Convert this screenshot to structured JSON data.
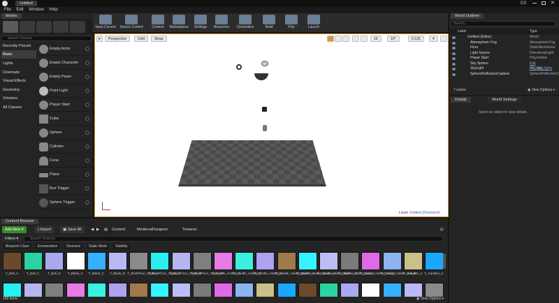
{
  "window": {
    "title": "Untitled",
    "user": "DS"
  },
  "menu": [
    "File",
    "Edit",
    "Window",
    "Help"
  ],
  "modes_tab": "Modes",
  "placement": {
    "search_placeholder": "Search Classes",
    "categories": [
      "Recently Placed",
      "Basic",
      "Lights",
      "Cinematic",
      "Visual Effects",
      "Geometry",
      "Volumes",
      "All Classes"
    ],
    "items": [
      "Empty Actor",
      "Empty Character",
      "Empty Pawn",
      "Point Light",
      "Player Start",
      "Cube",
      "Sphere",
      "Cylinder",
      "Cone",
      "Plane",
      "Box Trigger",
      "Sphere Trigger"
    ]
  },
  "toolbar": [
    {
      "label": "Save Current",
      "icon": "save-icon"
    },
    {
      "label": "Source Control",
      "icon": "source-control-icon"
    },
    {
      "label": "Content",
      "icon": "content-icon"
    },
    {
      "label": "Marketplace",
      "icon": "marketplace-icon"
    },
    {
      "label": "Settings",
      "icon": "settings-icon"
    },
    {
      "label": "Blueprints",
      "icon": "blueprints-icon"
    },
    {
      "label": "Cinematics",
      "icon": "cinematics-icon"
    },
    {
      "label": "Build",
      "icon": "build-icon"
    },
    {
      "label": "Play",
      "icon": "play-icon"
    },
    {
      "label": "Launch",
      "icon": "launch-icon"
    }
  ],
  "viewport": {
    "perspective": "Perspective",
    "lit": "Unlit",
    "show": "Show",
    "grid": "10",
    "angle": "10°",
    "scale": "0.125",
    "cam": "4",
    "level_label": "Level:",
    "level_name": "Untitled (Persistent)"
  },
  "outliner": {
    "tab": "World Outliner",
    "search_placeholder": "Search...",
    "col_label": "Label",
    "col_type": "Type",
    "rows": [
      {
        "label": "Untitled (Editor)",
        "type": "World"
      },
      {
        "label": "Atmospheric Fog",
        "type": "AtmosphericFog"
      },
      {
        "label": "Floor",
        "type": "StaticMeshActor"
      },
      {
        "label": "Light Source",
        "type": "DirectionalLight"
      },
      {
        "label": "Player Start",
        "type": "PlayerStart"
      },
      {
        "label": "Sky Sphere",
        "type": "Edit BP_Sky_Sphe"
      },
      {
        "label": "SkyLight",
        "type": "SkyLight"
      },
      {
        "label": "SphereReflectionCapture",
        "type": "SphereReflectionCa"
      }
    ],
    "count": "7 actors",
    "view_options": "View Options"
  },
  "details": {
    "tab": "Details",
    "tab2": "World Settings",
    "empty": "Select an object to view details."
  },
  "content_browser": {
    "tab": "Content Browser",
    "add_new": "Add New",
    "import": "Import",
    "save_all": "Save All",
    "path": [
      "Content",
      "MedievalDungeon",
      "Textures"
    ],
    "filters": "Filters",
    "search_placeholder": "Search Textures",
    "filter_tabs": [
      "Blueprint Class",
      "Enumeration",
      "Structure",
      "Static Mesh",
      "Stability"
    ],
    "assets": [
      "T_Ball_A",
      "T_Ball_C",
      "T_Ball_N",
      "T_Blank_A",
      "T_Blank_C",
      "T_Blank_N",
      "T_BrickFloor_Clean_A",
      "T_BrickFloor_Clean_C",
      "T_BrickFloor_Clean_N",
      "T_BrickFloor_Clean_M",
      "T_Candle_Holder_A",
      "T_Candle_Holder_C",
      "T_Candle_Holder_N",
      "T_Candle_Holder_Burner_A",
      "T_Candle_Holder_Burner_C",
      "T_Candle_Holder_Burner_N",
      "T_Candle_Holder_Iron_A",
      "T_Candle_Holder_Iron_C",
      "T_Candle_Holder_Iron_N",
      "T_Candles_A",
      "T_Candles_C"
    ],
    "count": "169 items",
    "view_options": "View Options"
  },
  "colors": {
    "accent": "#d89a2d",
    "tile_colors": [
      "#6b4a2a",
      "#2bd3a0",
      "#a9a9f0",
      "#ffffff",
      "#36b0ff",
      "#b9b9f5",
      "#8a8a8a",
      "#28f0f0",
      "#b5b5f0",
      "#7f7f7f",
      "#e87be8",
      "#3af0e0",
      "#b0a0f0",
      "#a07a4a",
      "#35f4ff",
      "#bdbdf5",
      "#7a7a7a",
      "#e06ae6",
      "#8cb4f0",
      "#c9c08a",
      "#1aa8ff"
    ]
  }
}
